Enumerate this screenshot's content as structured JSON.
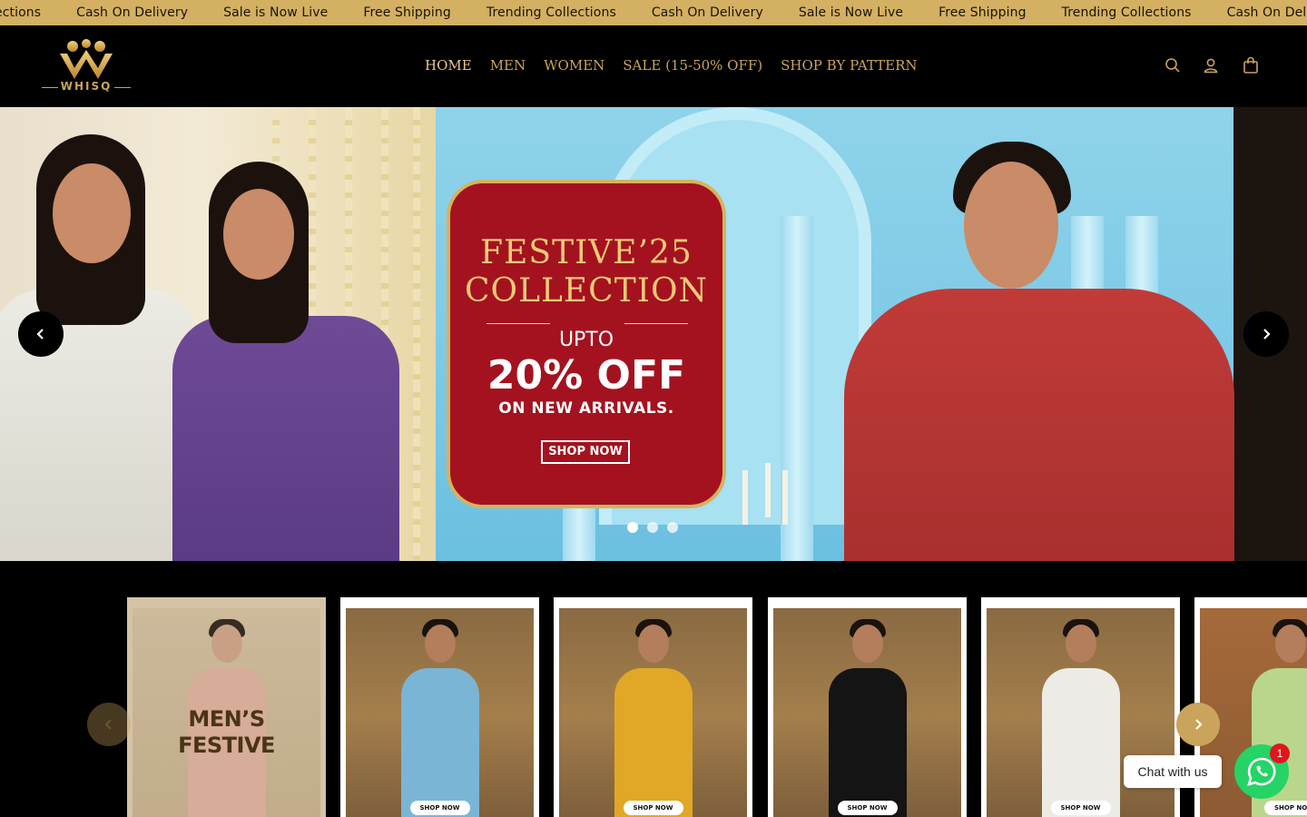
{
  "announcement": {
    "items": [
      "llections",
      "Cash On Delivery",
      "Sale is Now Live",
      "Free Shipping",
      "Trending Collections",
      "Cash On Delivery",
      "Sale is Now Live",
      "Free Shipping",
      "Trending Collections",
      "Cash On Deliv"
    ]
  },
  "header": {
    "logo_text": "WHISQ",
    "nav": [
      "HOME",
      "MEN",
      "WOMEN",
      "SALE (15-50% OFF)",
      "SHOP BY PATTERN"
    ],
    "active_nav": "HOME",
    "icons": [
      "search-icon",
      "account-icon",
      "cart-icon"
    ]
  },
  "hero": {
    "badge_line1": "FESTIVE’25",
    "badge_line2": "COLLECTION",
    "upto": "UPTO",
    "offer": "20% OFF",
    "subtext": "ON NEW ARRIVALS.",
    "cta": "SHOP NOW",
    "slide_count": 3,
    "active_slide": 1
  },
  "categories": {
    "first_title_line1": "MEN’S",
    "first_title_line2": "FESTIVE",
    "shop_label": "SHOP NOW",
    "cards": [
      {
        "kurta_color": "#7bb5d6"
      },
      {
        "kurta_color": "#e0a826"
      },
      {
        "kurta_color": "#141414"
      },
      {
        "kurta_color": "#ecebe6"
      },
      {
        "kurta_color": "#b9d68c"
      }
    ]
  },
  "chat": {
    "label": "Chat with us",
    "unread": "1"
  },
  "colors": {
    "accent_gold": "#c9a45a",
    "announcement_bg": "#d4b063",
    "badge_red": "#a4121f",
    "whatsapp_green": "#25d366"
  }
}
